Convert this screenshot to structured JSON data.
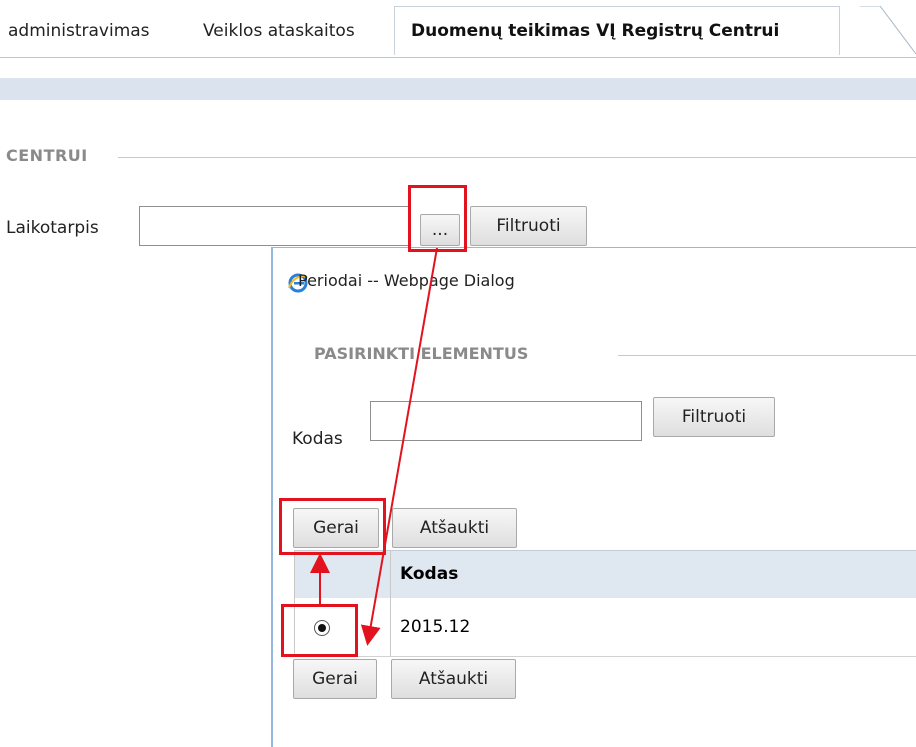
{
  "tabs": [
    {
      "label": "administravimas"
    },
    {
      "label": "Veiklos ataskaitos"
    },
    {
      "label": "Duomenų teikimas VĮ Registrų Centrui",
      "active": true
    }
  ],
  "main": {
    "section_title": "CENTRUI",
    "period_label": "Laikotarpis",
    "period_value": "",
    "browse_button": "...",
    "filter_button": "Filtruoti"
  },
  "dialog": {
    "title": "Periodai -- Webpage Dialog",
    "section_title": "PASIRINKTI ELEMENTUS",
    "code_label": "Kodas",
    "code_value": "",
    "filter_button": "Filtruoti",
    "ok_button": "Gerai",
    "cancel_button": "Atšaukti",
    "table": {
      "columns": [
        "Kodas"
      ],
      "rows": [
        {
          "selected": true,
          "code": "2015.12"
        }
      ]
    }
  },
  "colors": {
    "highlight": "#e2131e",
    "tab_border": "#c8d2dc",
    "subbar": "#dbe4ee",
    "grid_header": "#dfe7f0"
  },
  "icons": [
    "ie-icon",
    "radio-selected-icon",
    "arrow-annotation"
  ]
}
